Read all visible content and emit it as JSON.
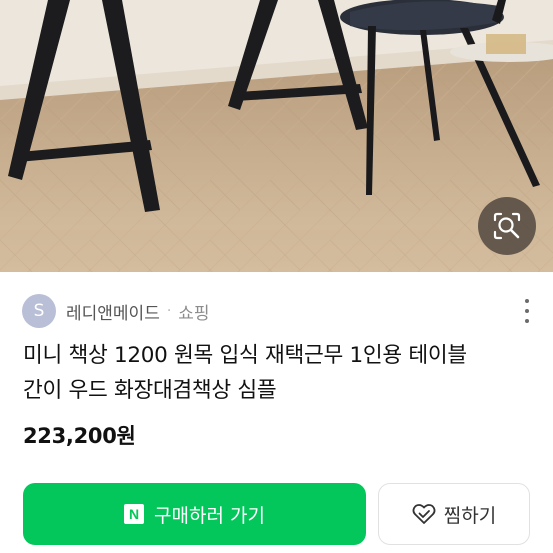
{
  "product_image": {
    "lens_button_icon": "image-search-lens-icon"
  },
  "seller": {
    "avatar_initial": "S",
    "name": "레디앤메이드",
    "separator": "·",
    "category": "쇼핑",
    "more_icon": "more-vertical-icon"
  },
  "product": {
    "title_line1": "미니 책상 1200 원목 입식 재택근무 1인용 테이블",
    "title_line2": "간이 우드 화장대겸책상 심플",
    "price": "223,200원"
  },
  "actions": {
    "buy_logo": "N",
    "buy_label": "구매하러 가기",
    "wish_icon": "heart-icon",
    "wish_label": "찜하기"
  },
  "colors": {
    "buy_button": "#03c75a",
    "avatar": "#b8bfd6",
    "text_primary": "#111111",
    "text_secondary": "#8c8c8c"
  }
}
